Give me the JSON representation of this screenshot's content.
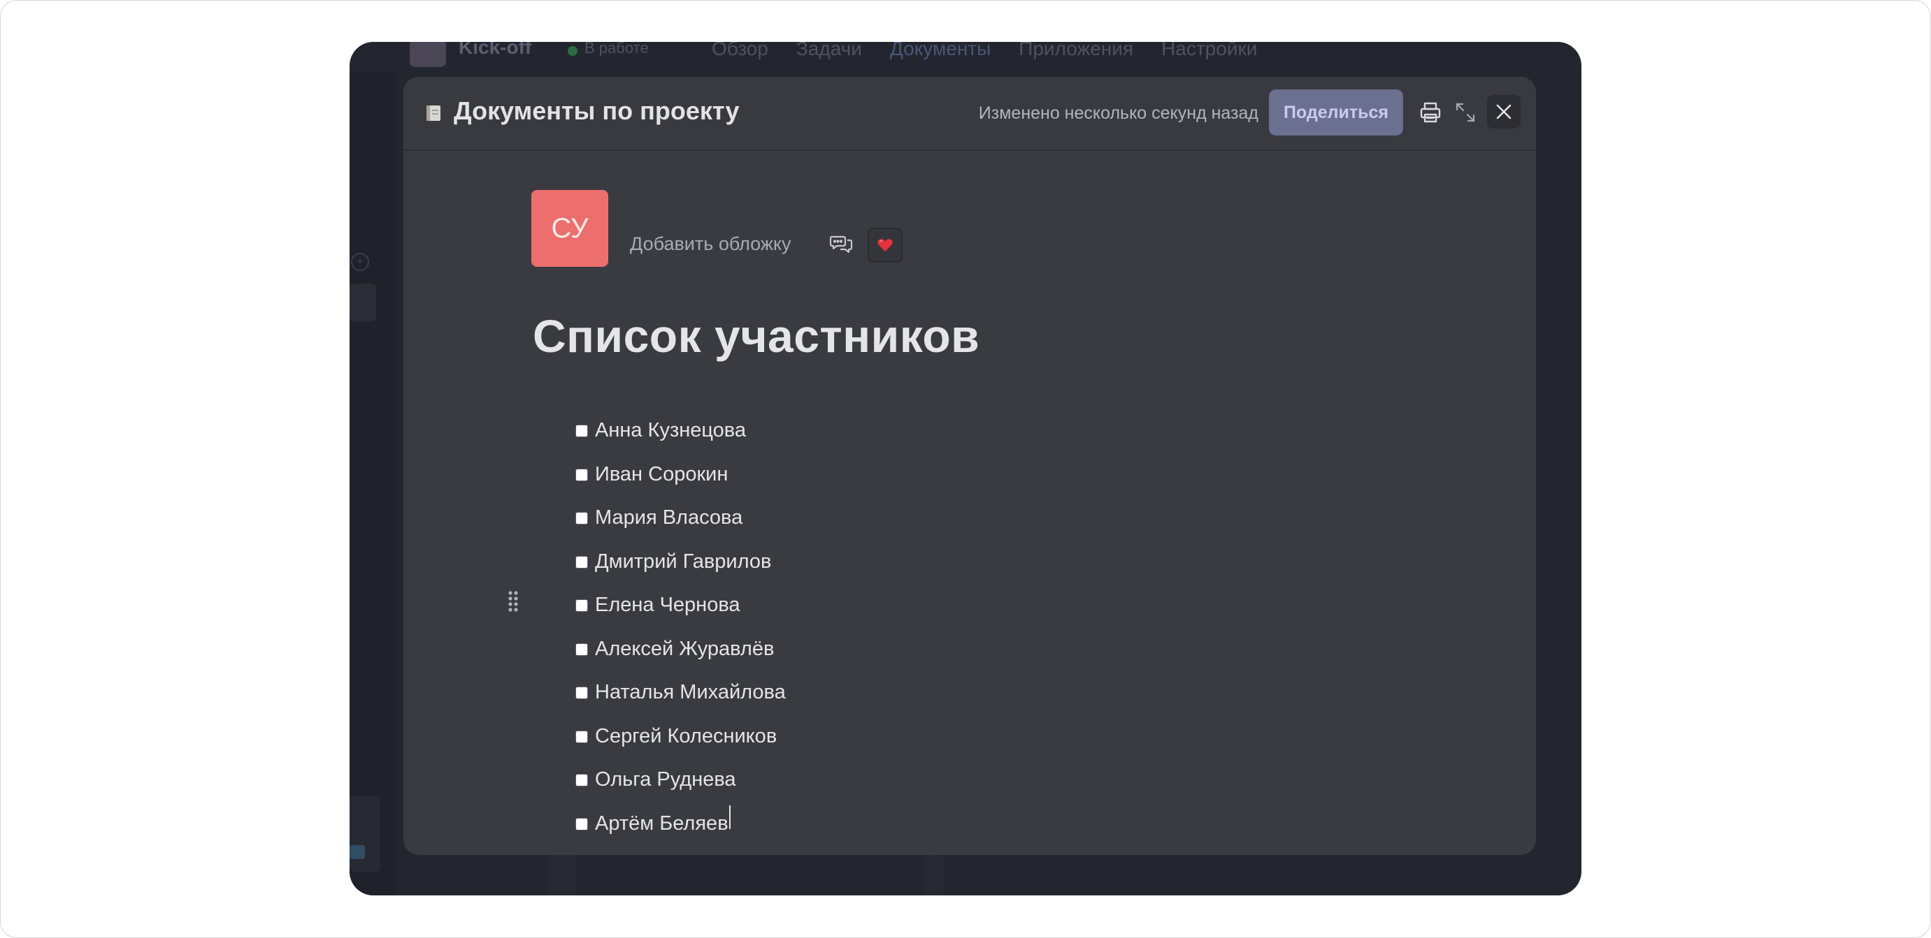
{
  "background_app": {
    "project_name": "Kick-off",
    "status": "В работе",
    "nav": [
      "Обзор",
      "Задачи",
      "Документы",
      "Приложения",
      "Настройки"
    ]
  },
  "modal": {
    "title": "Документы по проекту",
    "modified": "Изменено несколько секунд назад",
    "share_label": "Поделиться",
    "icons": {
      "document": "document-icon",
      "print": "printer-icon",
      "expand": "expand-icon",
      "close": "close-icon"
    }
  },
  "page": {
    "avatar_initials": "СУ",
    "avatar_color": "#ec6f6d",
    "add_cover_label": "Добавить обложку",
    "reaction_emoji": "❤️",
    "heading": "Список участников",
    "checklist": [
      "Анна Кузнецова",
      "Иван Сорокин",
      "Мария Власова",
      "Дмитрий Гаврилов",
      "Елена Чернова",
      "Алексей Журавлёв",
      "Наталья Михайлова",
      "Сергей Колесников",
      "Ольга Руднева",
      "Артём Беляев"
    ]
  },
  "colors": {
    "accent": "#6b6f90",
    "modal_bg": "#3a3b41",
    "app_bg": "#23262f"
  }
}
